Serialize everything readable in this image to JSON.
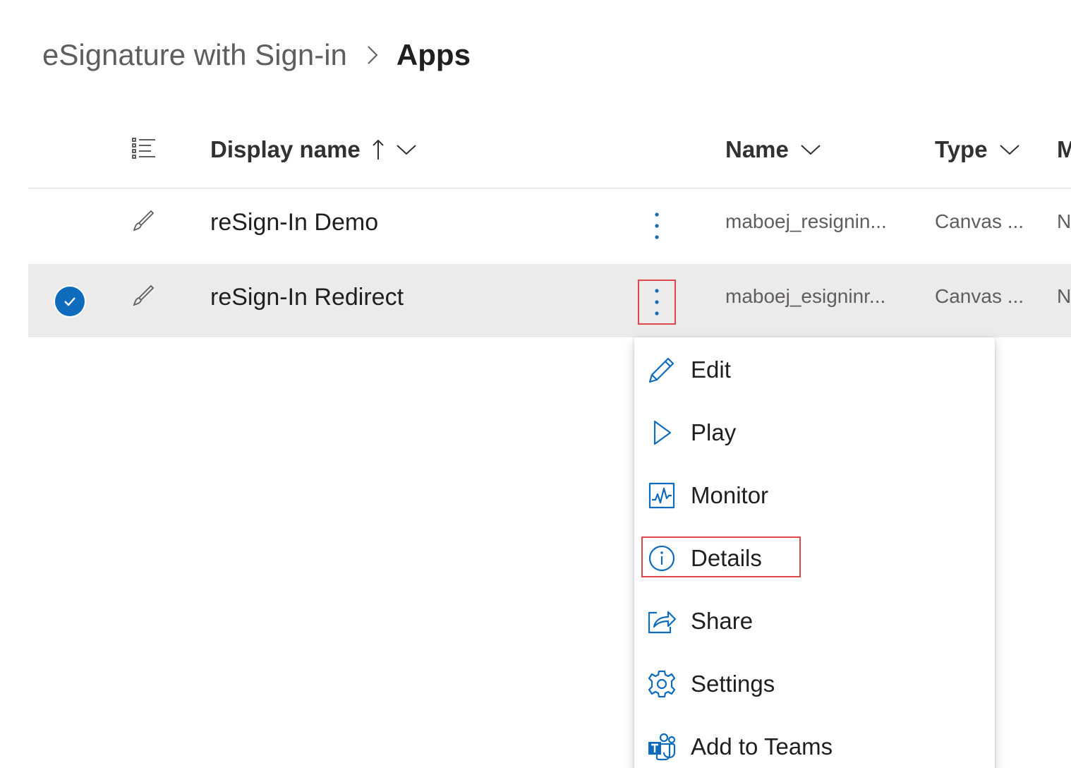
{
  "breadcrumb": {
    "parent": "eSignature with Sign-in",
    "current": "Apps"
  },
  "table": {
    "columns": {
      "display_name": "Display name",
      "name": "Name",
      "type": "Type",
      "modified_partial": "M"
    },
    "rows": [
      {
        "display_name": "reSign-In Demo",
        "name": "maboej_resignin...",
        "type": "Canvas ...",
        "next_partial": "N",
        "selected": false
      },
      {
        "display_name": "reSign-In Redirect",
        "name": "maboej_esigninr...",
        "type": "Canvas ...",
        "next_partial": "N",
        "selected": true
      }
    ]
  },
  "context_menu": {
    "items": [
      {
        "label": "Edit",
        "icon": "pencil-icon"
      },
      {
        "label": "Play",
        "icon": "play-icon"
      },
      {
        "label": "Monitor",
        "icon": "monitor-icon"
      },
      {
        "label": "Details",
        "icon": "info-icon"
      },
      {
        "label": "Share",
        "icon": "share-icon"
      },
      {
        "label": "Settings",
        "icon": "gear-icon"
      },
      {
        "label": "Add to Teams",
        "icon": "teams-icon"
      }
    ]
  },
  "colors": {
    "accent": "#0f6cbd",
    "highlight_box": "#e0474c",
    "selected_row": "#edebe9"
  }
}
